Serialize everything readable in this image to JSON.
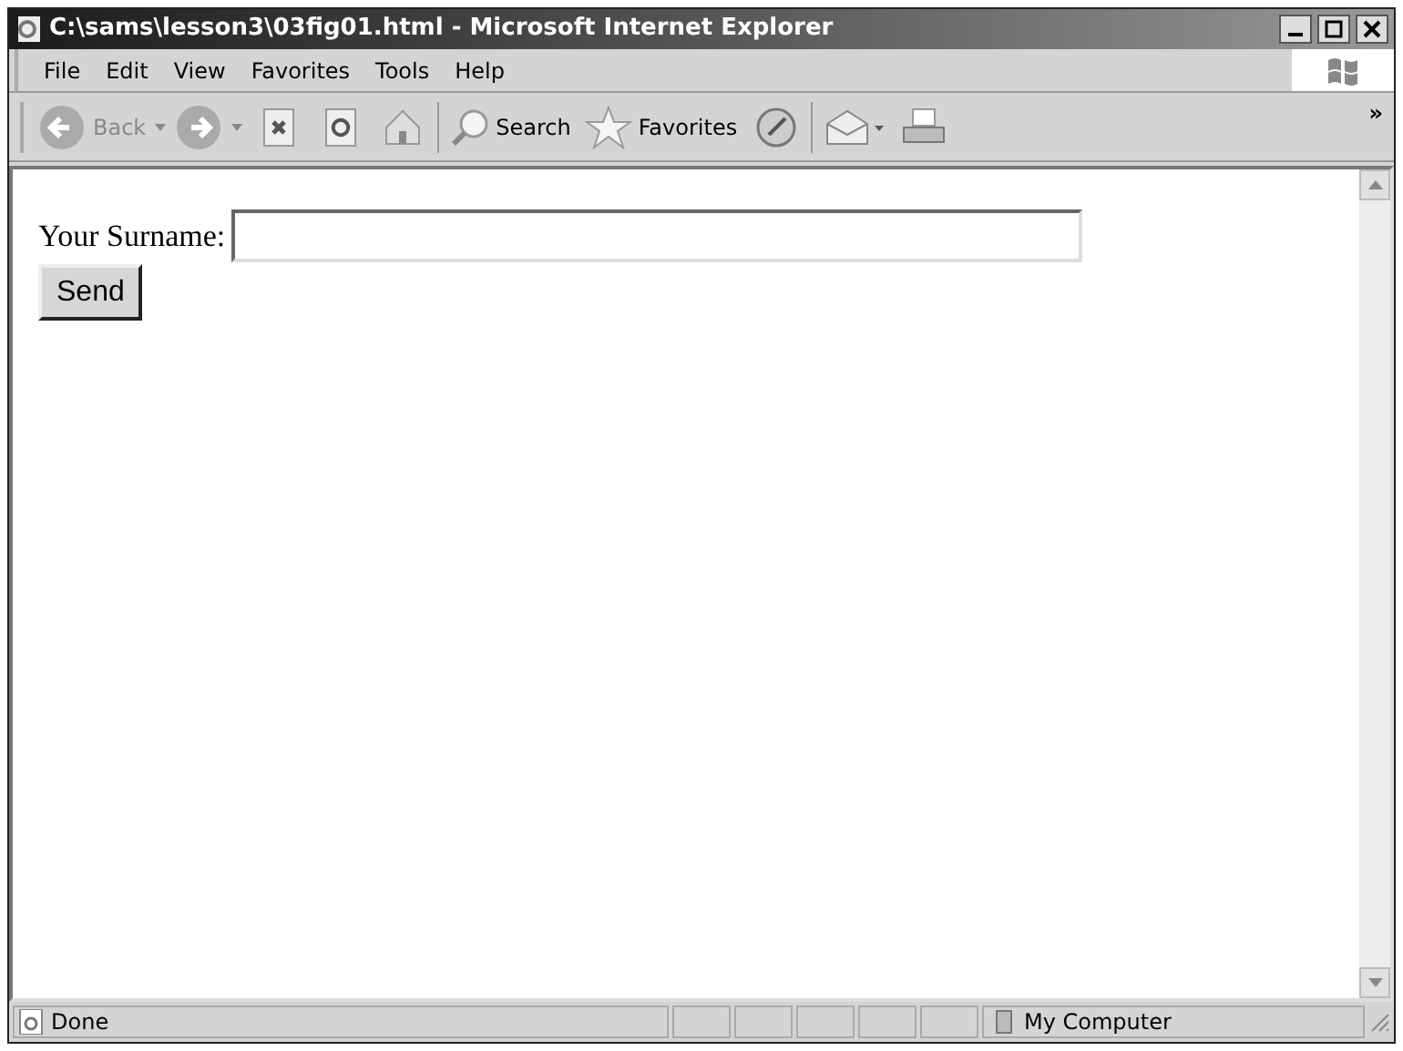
{
  "window": {
    "title": "C:\\sams\\lesson3\\03fig01.html - Microsoft Internet Explorer"
  },
  "menu": [
    "File",
    "Edit",
    "View",
    "Favorites",
    "Tools",
    "Help"
  ],
  "toolbar": {
    "back": "Back",
    "search": "Search",
    "favorites": "Favorites",
    "overflow": "»"
  },
  "form": {
    "label": "Your Surname:",
    "button": "Send"
  },
  "status_bar": {
    "text": "Done",
    "zone": "My Computer"
  }
}
